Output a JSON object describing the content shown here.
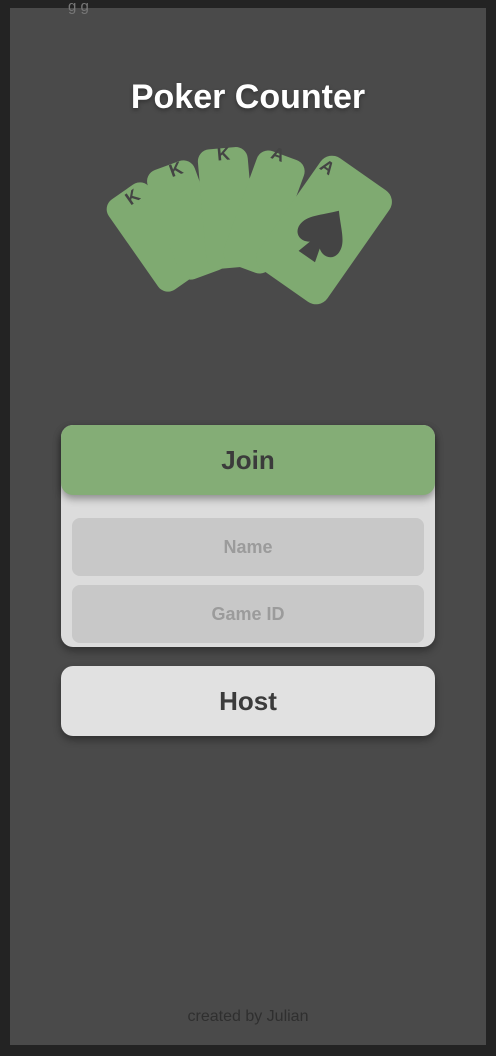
{
  "app": {
    "title": "Poker Counter",
    "top_fragment": "g g"
  },
  "logo": {
    "icon": "playing-cards-fan-icon",
    "cards": [
      "K",
      "K",
      "K",
      "A",
      "A"
    ],
    "suit": "spade",
    "card_color": "#7faa71",
    "letter_color": "#444444"
  },
  "join": {
    "label": "Join",
    "color": "#84ad76",
    "name_placeholder": "Name",
    "name_value": "",
    "gameid_placeholder": "Game ID",
    "gameid_value": ""
  },
  "host": {
    "label": "Host"
  },
  "footer": {
    "text": "created by Julian"
  },
  "colors": {
    "background": "#4a4a4a",
    "outer": "#232323",
    "panel": "#dcdcdc",
    "field": "#c8c8c8"
  }
}
